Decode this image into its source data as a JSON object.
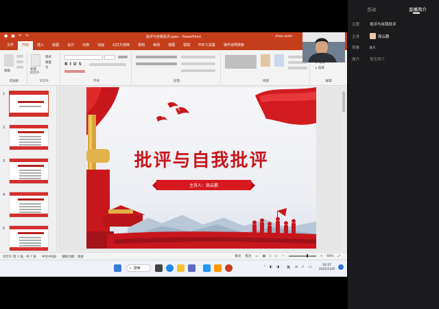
{
  "side_panel": {
    "tabs": [
      "互动",
      "直播简介"
    ],
    "active_tab": 1,
    "rows": [
      {
        "label": "主题",
        "value": "批评与自我批评"
      },
      {
        "label": "主讲",
        "value": "周云鹏"
      },
      {
        "label": "观看",
        "value": "8人"
      },
      {
        "label": "简介",
        "value": "暂无简介"
      }
    ]
  },
  "ppt": {
    "window_title": "批评与自我批评.pptx - PowerPoint",
    "user": "zhou auto",
    "ribbon_tabs": [
      "文件",
      "开始",
      "插入",
      "绘图",
      "设计",
      "切换",
      "动画",
      "幻灯片放映",
      "录制",
      "审阅",
      "视图",
      "帮助",
      "PDF工具集",
      "操作说明搜索"
    ],
    "active_ribbon_tab": 1,
    "groups": [
      "剪贴板",
      "幻灯片",
      "字体",
      "段落",
      "绘图",
      "编辑"
    ],
    "ribbon_buttons": {
      "paste": "粘贴",
      "new_slide": "新建\n幻灯片",
      "layout": "版式",
      "reset": "重置",
      "section": "节",
      "find": "查找",
      "replace": "替换",
      "select": "选择"
    },
    "thumb_numbers": [
      "1",
      "2",
      "3",
      "4",
      "5"
    ],
    "selected_thumb": 0,
    "slide": {
      "title": "批评与自我批评",
      "presenter": "主持人：周云鹏"
    },
    "status": {
      "slide_info": "幻灯片 第 1 张，共 7 张",
      "language": "中文(中国)",
      "accessibility": "辅助功能：调查",
      "notes": "备注",
      "comments": "批注",
      "zoom": "66%"
    }
  },
  "taskbar": {
    "search_label": "搜索",
    "tray_lang": "英",
    "time": "10:37",
    "date": "2022/12/6"
  },
  "colors": {
    "ppt_accent": "#c43e1c",
    "slide_red": "#c8161d",
    "side_bg": "#1b1b1d"
  }
}
